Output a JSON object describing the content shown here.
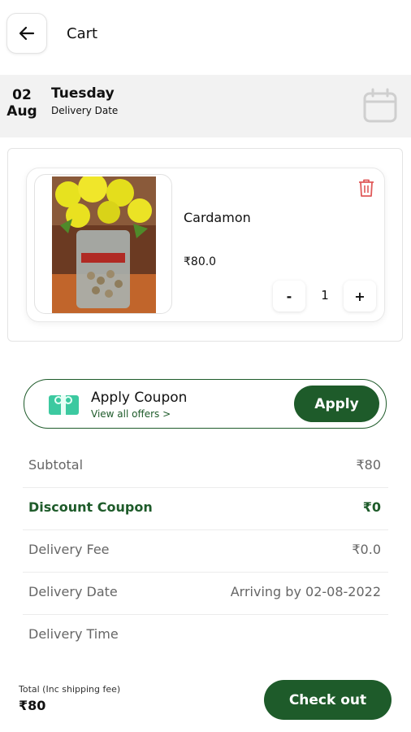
{
  "header": {
    "title": "Cart"
  },
  "delivery": {
    "day_num": "02",
    "month": "Aug",
    "weekday": "Tuesday",
    "label": "Delivery Date"
  },
  "item": {
    "name": "Cardamon",
    "price": "₹80.0",
    "qty": "1",
    "minus": "-",
    "plus": "+"
  },
  "coupon": {
    "title": "Apply Coupon",
    "subtitle": "View all offers >",
    "button": "Apply"
  },
  "summary": [
    {
      "label": "Subtotal",
      "value": "₹80"
    },
    {
      "label": "Discount Coupon",
      "value": "₹0"
    },
    {
      "label": "Delivery Fee",
      "value": "₹0.0"
    },
    {
      "label": "Delivery Date",
      "value": "Arriving by 02-08-2022"
    },
    {
      "label": "Delivery Time",
      "value": ""
    }
  ],
  "footer": {
    "total_label": "Total (Inc shipping fee)",
    "total_value": "₹80",
    "checkout": "Check out"
  },
  "colors": {
    "accent": "#1e5b2a",
    "delete": "#e05a5a"
  }
}
